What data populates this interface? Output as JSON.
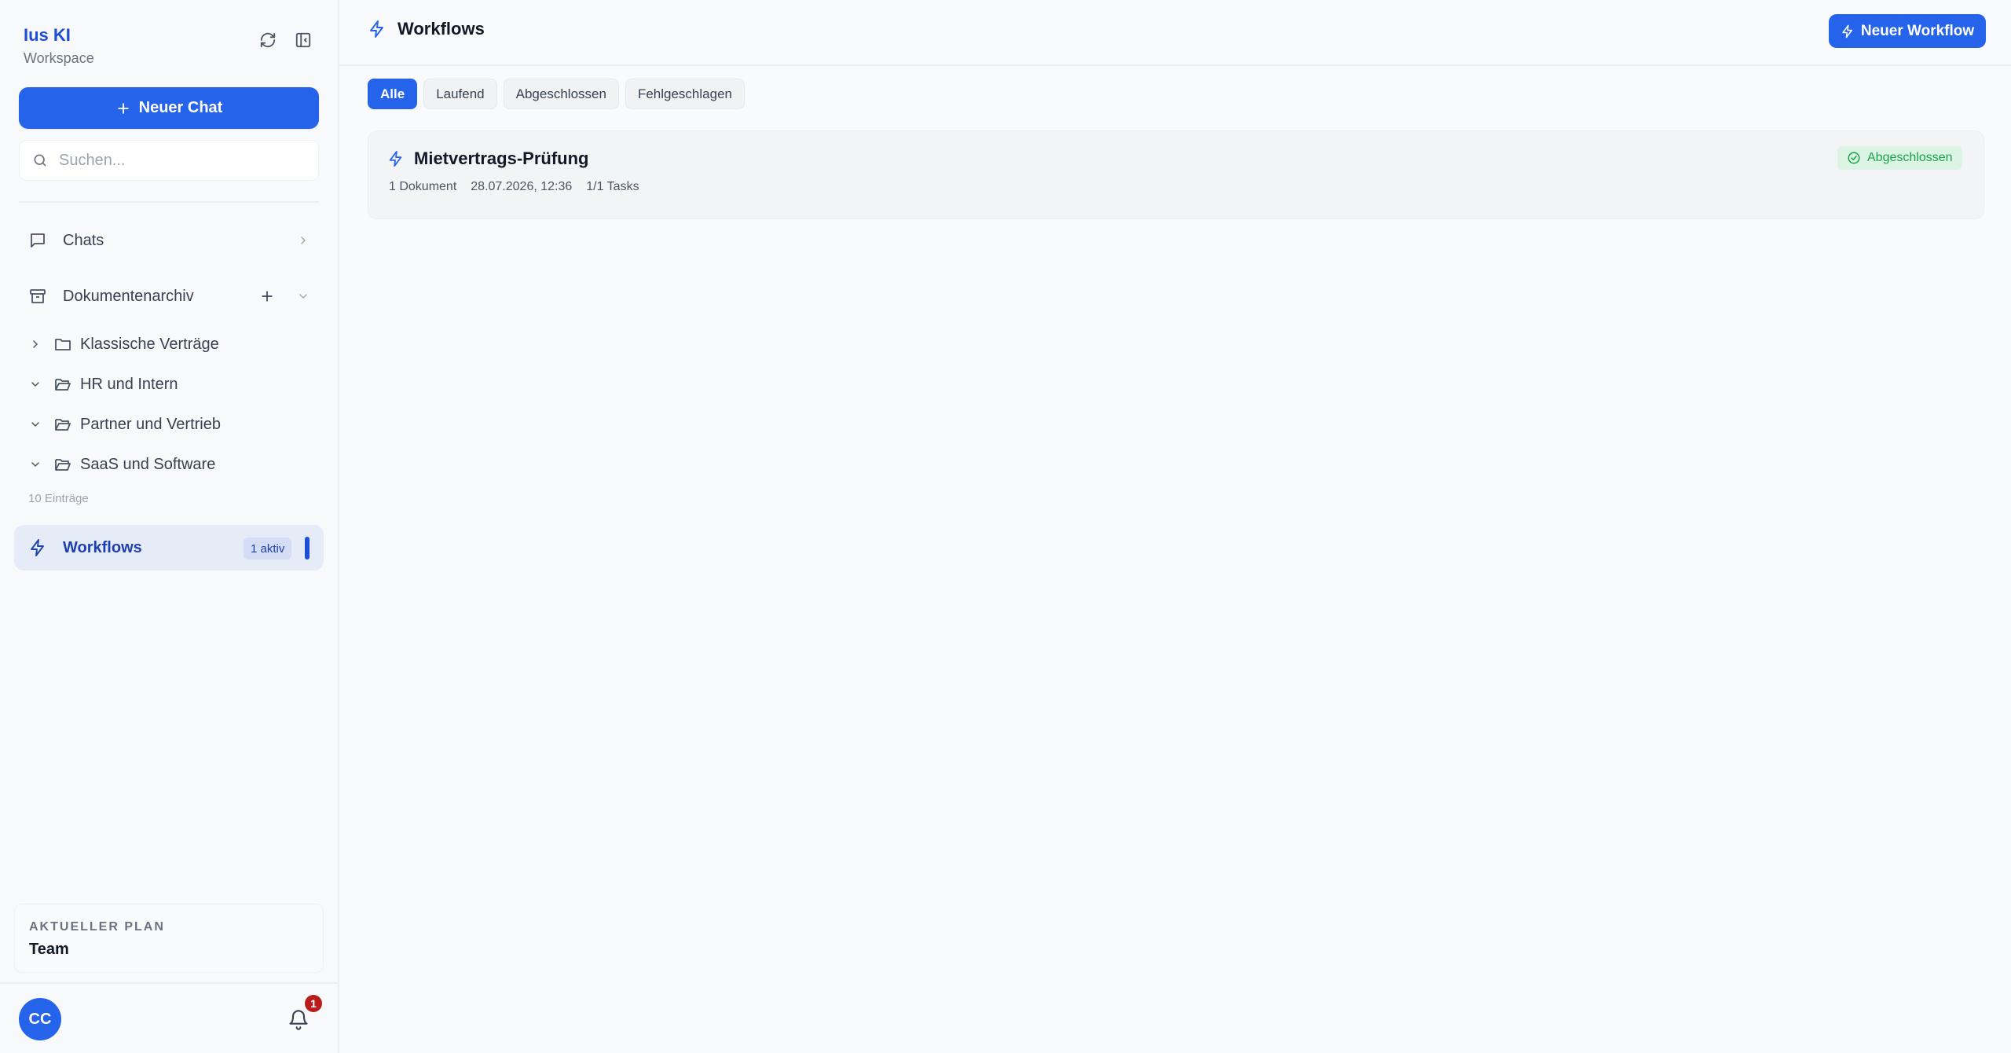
{
  "sidebar": {
    "brand_title": "Ius KI",
    "brand_subtitle": "Workspace",
    "new_chat_label": "Neuer Chat",
    "search_placeholder": "Suchen...",
    "chats_label": "Chats",
    "archive_label": "Dokumentenarchiv",
    "folders": [
      {
        "label": "Klassische Verträge",
        "expanded": false
      },
      {
        "label": "HR und Intern",
        "expanded": true
      },
      {
        "label": "Partner und Vertrieb",
        "expanded": true
      },
      {
        "label": "SaaS und Software",
        "expanded": true
      }
    ],
    "entries_count": "10 Einträge",
    "workflows_label": "Workflows",
    "workflows_badge": "1 aktiv",
    "plan_label": "AKTUELLER PLAN",
    "plan_value": "Team",
    "avatar_initials": "CC",
    "notifications_count": "1"
  },
  "main": {
    "title": "Workflows",
    "new_workflow_label": "Neuer Workflow",
    "filters": [
      {
        "label": "Alle",
        "active": true
      },
      {
        "label": "Laufend",
        "active": false
      },
      {
        "label": "Abgeschlossen",
        "active": false
      },
      {
        "label": "Fehlgeschlagen",
        "active": false
      }
    ],
    "workflows": [
      {
        "title": "Mietvertrags-Prüfung",
        "documents": "1 Dokument",
        "timestamp": "28.07.2026, 12:36",
        "tasks": "1/1 Tasks",
        "status": "Abgeschlossen"
      }
    ]
  },
  "colors": {
    "accent": "#2563eb",
    "status_success": "#16a34a",
    "notification_badge": "#b91c1c"
  }
}
